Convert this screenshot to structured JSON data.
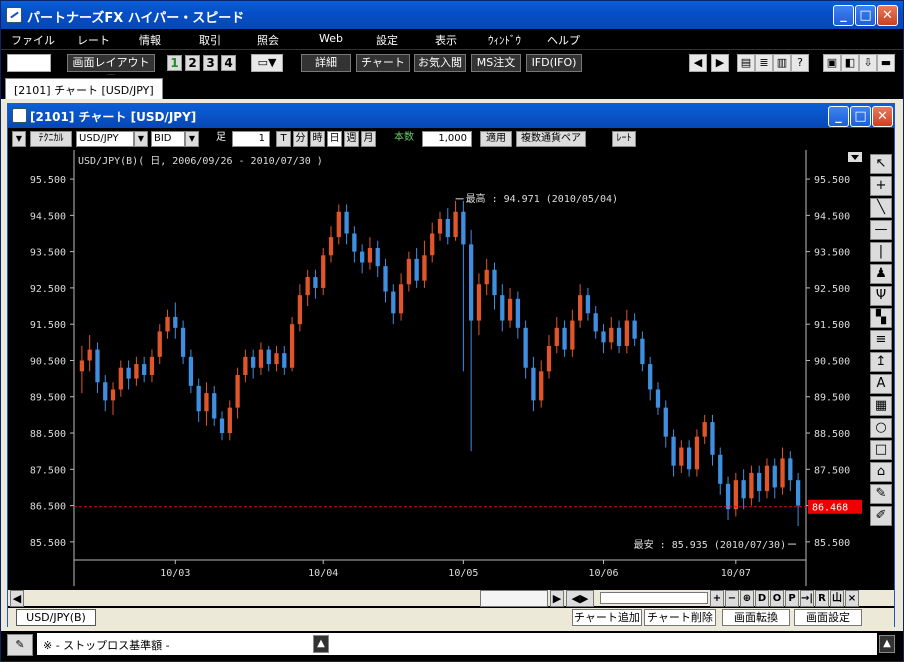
{
  "app": {
    "title": "パートナーズFX ハイパー・スピード"
  },
  "menu": [
    "ファイル",
    "レート",
    "情報",
    "取引",
    "照会",
    "Web",
    "設定",
    "表示",
    "ｳｨﾝﾄﾞｳ",
    "ヘルプ"
  ],
  "toolbar": {
    "layout": "画面レイアウト",
    "screens": [
      "1",
      "2",
      "3",
      "4"
    ],
    "buttons": [
      "詳細",
      "チャート",
      "お気入閲",
      "MS注文",
      "IFD(IFO)"
    ]
  },
  "tab": {
    "label": "[2101] チャート [USD/JPY]"
  },
  "chart_window": {
    "title": "[2101] チャート [USD/JPY]",
    "technical_label": "ﾃｸﾆｶﾙ",
    "pair": "USD/JPY",
    "side": "BID",
    "foot_label": "足",
    "interval_value": "1",
    "interval_units": [
      "T",
      "分",
      "時",
      "日",
      "週",
      "月"
    ],
    "count_label": "本数",
    "count_value": "1,000",
    "apply": "適用",
    "multi_pair": "複数通貨ペア",
    "rate_btn": "ﾚｰﾄ"
  },
  "chart_data": {
    "type": "candlestick",
    "title": "USD/JPY(B)( 日, 2006/09/26 - 2010/07/30 )",
    "y_ticks": [
      "95.500",
      "94.500",
      "93.500",
      "92.500",
      "91.500",
      "90.500",
      "89.500",
      "88.500",
      "87.500",
      "86.500",
      "85.500"
    ],
    "ylim": [
      85.0,
      95.75
    ],
    "x_ticks": [
      "10/03",
      "10/04",
      "10/05",
      "10/06",
      "10/07"
    ],
    "high_label": "最高 : 94.971 (2010/05/04)",
    "low_label": "最安 : 85.935 (2010/07/30)",
    "current_price_label": "86.468",
    "current_price": 86.468,
    "colors": {
      "up": "#e0562a",
      "down": "#3f8fe0",
      "current_line": "#d11",
      "axis": "#bbbbbb"
    },
    "candles": [
      [
        90.2,
        90.5,
        89.6,
        90.9
      ],
      [
        90.5,
        90.8,
        90.2,
        91.2
      ],
      [
        90.8,
        89.9,
        89.6,
        91.0
      ],
      [
        89.9,
        89.4,
        89.1,
        90.1
      ],
      [
        89.4,
        89.7,
        89.0,
        89.9
      ],
      [
        89.7,
        90.3,
        89.5,
        90.5
      ],
      [
        90.3,
        90.0,
        89.7,
        90.5
      ],
      [
        90.0,
        90.4,
        89.8,
        90.6
      ],
      [
        90.4,
        90.1,
        89.9,
        90.6
      ],
      [
        90.1,
        90.6,
        89.9,
        90.8
      ],
      [
        90.6,
        91.3,
        90.4,
        91.5
      ],
      [
        91.3,
        91.7,
        91.1,
        91.9
      ],
      [
        91.7,
        91.4,
        91.1,
        92.1
      ],
      [
        91.4,
        90.6,
        90.4,
        91.6
      ],
      [
        90.6,
        89.8,
        89.6,
        90.8
      ],
      [
        89.8,
        89.1,
        88.8,
        90.0
      ],
      [
        89.1,
        89.6,
        88.7,
        89.9
      ],
      [
        89.6,
        88.9,
        88.7,
        89.8
      ],
      [
        88.9,
        88.5,
        88.3,
        89.1
      ],
      [
        88.5,
        89.2,
        88.3,
        89.4
      ],
      [
        89.2,
        90.1,
        88.9,
        90.3
      ],
      [
        90.1,
        90.6,
        89.9,
        90.8
      ],
      [
        90.6,
        90.3,
        90.0,
        90.8
      ],
      [
        90.3,
        90.8,
        90.1,
        91.0
      ],
      [
        90.8,
        90.4,
        90.2,
        90.9
      ],
      [
        90.4,
        90.7,
        90.2,
        90.9
      ],
      [
        90.7,
        90.3,
        90.1,
        90.9
      ],
      [
        90.3,
        91.5,
        90.2,
        91.7
      ],
      [
        91.5,
        92.3,
        91.3,
        92.6
      ],
      [
        92.3,
        92.8,
        92.0,
        93.0
      ],
      [
        92.8,
        92.5,
        92.2,
        93.0
      ],
      [
        92.5,
        93.4,
        92.3,
        93.6
      ],
      [
        93.4,
        93.9,
        93.2,
        94.2
      ],
      [
        93.9,
        94.6,
        93.7,
        94.8
      ],
      [
        94.6,
        94.0,
        93.7,
        94.8
      ],
      [
        94.0,
        93.5,
        93.2,
        94.2
      ],
      [
        93.5,
        93.2,
        92.9,
        93.7
      ],
      [
        93.2,
        93.6,
        93.0,
        93.9
      ],
      [
        93.6,
        93.1,
        92.8,
        93.8
      ],
      [
        93.1,
        92.4,
        92.1,
        93.3
      ],
      [
        92.4,
        91.8,
        91.5,
        92.6
      ],
      [
        91.8,
        92.6,
        91.6,
        92.9
      ],
      [
        92.6,
        93.3,
        92.4,
        93.5
      ],
      [
        93.3,
        92.7,
        92.5,
        93.6
      ],
      [
        92.7,
        93.4,
        92.5,
        93.8
      ],
      [
        93.4,
        94.0,
        93.2,
        94.3
      ],
      [
        94.0,
        94.4,
        93.8,
        94.6
      ],
      [
        94.4,
        93.9,
        93.7,
        94.7
      ],
      [
        93.9,
        94.6,
        93.8,
        94.9
      ],
      [
        94.6,
        93.7,
        90.2,
        94.9
      ],
      [
        93.7,
        91.6,
        88.0,
        94.1
      ],
      [
        91.6,
        92.6,
        91.2,
        92.9
      ],
      [
        92.6,
        93.0,
        92.3,
        93.3
      ],
      [
        93.0,
        92.3,
        91.9,
        93.2
      ],
      [
        92.3,
        91.6,
        91.3,
        92.6
      ],
      [
        91.6,
        92.2,
        91.4,
        92.5
      ],
      [
        92.2,
        91.4,
        91.1,
        92.4
      ],
      [
        91.4,
        90.3,
        90.0,
        91.6
      ],
      [
        90.3,
        89.4,
        89.1,
        90.6
      ],
      [
        89.4,
        90.2,
        89.2,
        90.5
      ],
      [
        90.2,
        90.9,
        90.0,
        91.2
      ],
      [
        90.9,
        91.4,
        90.7,
        91.7
      ],
      [
        91.4,
        90.8,
        90.6,
        91.6
      ],
      [
        90.8,
        91.6,
        90.6,
        91.9
      ],
      [
        91.6,
        92.3,
        91.4,
        92.6
      ],
      [
        92.3,
        91.8,
        91.6,
        92.5
      ],
      [
        91.8,
        91.3,
        91.1,
        92.0
      ],
      [
        91.3,
        91.0,
        90.7,
        91.5
      ],
      [
        91.0,
        91.4,
        90.8,
        91.7
      ],
      [
        91.4,
        90.9,
        90.7,
        91.6
      ],
      [
        90.9,
        91.6,
        90.7,
        91.9
      ],
      [
        91.6,
        91.1,
        90.9,
        91.8
      ],
      [
        91.1,
        90.4,
        90.2,
        91.3
      ],
      [
        90.4,
        89.7,
        89.4,
        90.6
      ],
      [
        89.7,
        89.2,
        89.0,
        89.9
      ],
      [
        89.2,
        88.4,
        88.1,
        89.4
      ],
      [
        88.4,
        87.6,
        87.3,
        88.6
      ],
      [
        87.6,
        88.1,
        87.4,
        88.3
      ],
      [
        88.1,
        87.5,
        87.3,
        88.3
      ],
      [
        87.5,
        88.4,
        87.3,
        88.6
      ],
      [
        88.4,
        88.8,
        88.2,
        89.0
      ],
      [
        88.8,
        87.9,
        87.6,
        89.0
      ],
      [
        87.9,
        87.1,
        86.8,
        88.1
      ],
      [
        87.1,
        86.4,
        86.1,
        87.3
      ],
      [
        86.4,
        87.2,
        86.2,
        87.4
      ],
      [
        87.2,
        86.7,
        86.4,
        87.5
      ],
      [
        86.7,
        87.4,
        86.5,
        87.6
      ],
      [
        87.4,
        86.9,
        86.6,
        87.6
      ],
      [
        86.9,
        87.6,
        86.7,
        87.8
      ],
      [
        87.6,
        87.0,
        86.7,
        87.8
      ],
      [
        87.0,
        87.8,
        86.8,
        88.1
      ],
      [
        87.8,
        87.2,
        86.9,
        88.0
      ],
      [
        87.2,
        86.5,
        85.935,
        87.4
      ]
    ]
  },
  "right_tools": [
    "↖",
    "+",
    "╲",
    "—",
    "|",
    "♟",
    "Ψ",
    "▚",
    "≡",
    "↥",
    "A",
    "▦",
    "○",
    "□",
    "⌂",
    "✎",
    "✐"
  ],
  "scroll_buttons": [
    "+",
    "−",
    "⊕",
    "D",
    "O",
    "P",
    "→|",
    "R",
    "山",
    "×"
  ],
  "chart_tab": "USD/JPY(B)",
  "bottom_buttons": [
    "チャート追加",
    "チャート削除",
    "画面転換",
    "画面設定"
  ],
  "status": {
    "text": "※ - ストップロス基準額 -"
  }
}
